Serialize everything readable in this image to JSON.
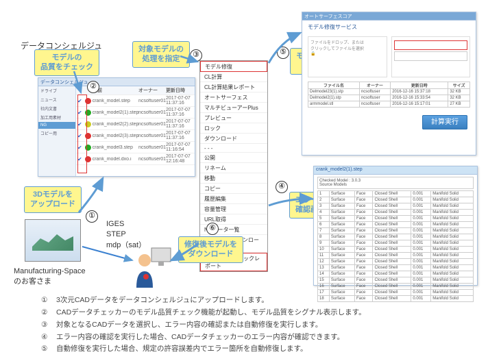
{
  "diagram_title": "データコンシェルジュ",
  "customer_label": "Manufacturing-Space\nのお客さま",
  "formats": [
    "IGES",
    "STEP",
    "mdp（sat）"
  ],
  "callouts": {
    "c_upload": "3Dモデルを\nアップロード",
    "c_quality": "モデルの\n品質をチェック",
    "c_target": "対象モデルの\n処理を指定",
    "c_autorepair": "モデル自動修復\n実行画面へ",
    "c_error": "エラー内容\n確認画面へ",
    "c_download": "修復後モデルを\nダウンロード"
  },
  "steps": {
    "s1": "①",
    "s2": "②",
    "s3": "③",
    "s4": "④",
    "s5": "⑤",
    "s6": "⑥"
  },
  "file_list": {
    "window_title": "データコンシェルジュ",
    "sidebar": [
      "ドライブ",
      "ニュース",
      "社内文書",
      "加工用素材",
      "NG",
      "コピー用"
    ],
    "cols": {
      "name": "名前",
      "owner": "オーナー",
      "date": "更新日時"
    },
    "rows": [
      {
        "sig": "red",
        "name": "crank_model.step",
        "owner": "ncsoftuser012",
        "date": "2017-07-07 11:37:16"
      },
      {
        "sig": "grn",
        "name": "crank_model2(1).step",
        "owner": "ncsoftuser012",
        "date": "2017-07-07 11:37:16"
      },
      {
        "sig": "yel",
        "name": "crank_model2(2).step",
        "owner": "ncsoftuser012",
        "date": "2017-07-07 11:37:16"
      },
      {
        "sig": "red",
        "name": "crank_model2(3).step",
        "owner": "ncsoftuser012",
        "date": "2017-07-07 11:37:16"
      },
      {
        "sig": "grn",
        "name": "crank_model3.step",
        "owner": "ncsoftuser012",
        "date": "2017-07-07 11:16:54"
      },
      {
        "sig": "red",
        "name": "crank_model.dxo.i",
        "owner": "ncsoftuser012",
        "date": "2017-07-07 12:16:48"
      }
    ]
  },
  "context_menu": [
    {
      "label": "モデル修復",
      "hl": true
    },
    {
      "label": "CL計算"
    },
    {
      "label": "CL計算結果レポート"
    },
    {
      "label": "オートサーフェス"
    },
    {
      "label": "マルチビューアーPlus"
    },
    {
      "label": "プレビュー"
    },
    {
      "label": "ロック"
    },
    {
      "label": "ダウンロード"
    },
    {
      "label": "- - -"
    },
    {
      "label": "公開"
    },
    {
      "label": "リネーム"
    },
    {
      "label": "移動"
    },
    {
      "label": "コピー"
    },
    {
      "label": "履歴編集"
    },
    {
      "label": "容量管理"
    },
    {
      "label": "URL取得"
    },
    {
      "label": "NCデータ一覧"
    },
    {
      "label": "加工指示書ダウンロード"
    },
    {
      "label": "モデル品質チェックレポート",
      "hl": true
    }
  ],
  "repair_screen": {
    "title": "オートサーフェスコア",
    "subtitle": "モデル修復サービス",
    "button": "計算実行",
    "table": [
      {
        "name": "ファイル名",
        "owner": "オーナー",
        "date": "更新日時",
        "size": "サイズ"
      },
      {
        "name": "Delmodel23(1).stp",
        "owner": "ncsoftuser",
        "date": "2016-12-16 15:37:18",
        "size": "32 KB"
      },
      {
        "name": "Delmodel2(1).stp",
        "owner": "ncsoftuser",
        "date": "2016-12-16 15:33:54",
        "size": "32 KB"
      },
      {
        "name": "armmodel.stl",
        "owner": "ncsoftuser",
        "date": "2016-12-16 15:17:01",
        "size": "27 KB"
      }
    ]
  },
  "error_screen": {
    "filename": "crank_model2(1).step",
    "header_l": "Checked Model",
    "header_r": "Source Models",
    "rows_count": 18
  },
  "footer": [
    "3次元CADデータをデータコンシェルジュにアップロードします。",
    "CADデータチェッカーのモデル品質チェック機能が起動し、モデル品質をシグナル表示します。",
    "対象となるCADデータを選択し、エラー内容の確認または自動修復を実行します。",
    "エラー内容の確認を実行した場合、CADデータチェッカーのエラー内容が確認できます。",
    "自動修復を実行した場合、規定の許容誤差内でエラー箇所を自動修復します。"
  ]
}
